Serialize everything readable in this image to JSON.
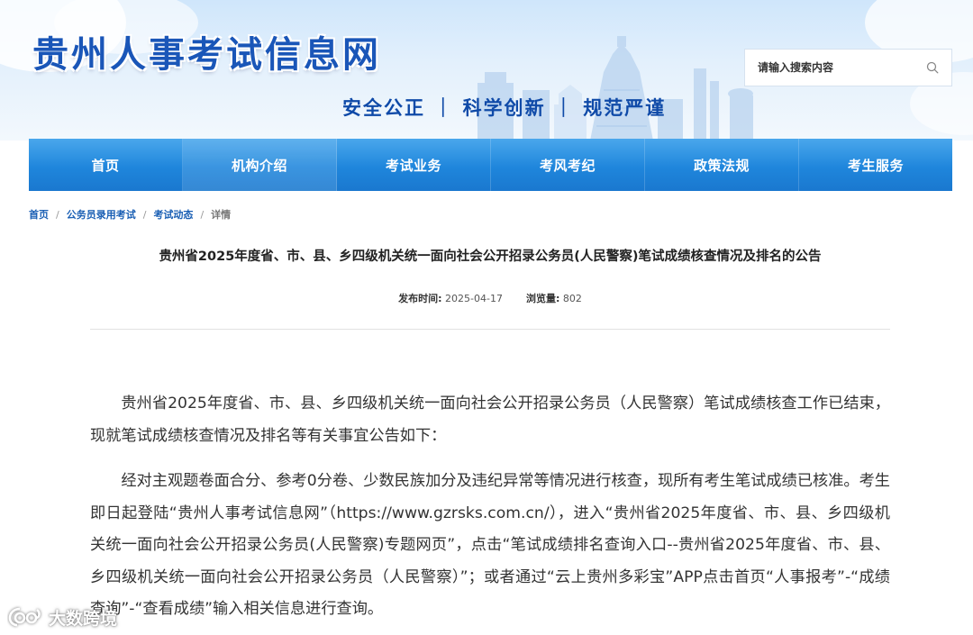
{
  "header": {
    "site_title": "贵州人事考试信息网",
    "slogan": "安全公正 ｜ 科学创新 ｜ 规范严谨",
    "search_placeholder": "请输入搜索内容"
  },
  "nav": {
    "items": [
      {
        "label": "首页"
      },
      {
        "label": "机构介绍"
      },
      {
        "label": "考试业务"
      },
      {
        "label": "考风考纪"
      },
      {
        "label": "政策法规"
      },
      {
        "label": "考生服务"
      }
    ]
  },
  "breadcrumb": {
    "items": [
      "首页",
      "公务员录用考试",
      "考试动态"
    ],
    "current": "详情"
  },
  "article": {
    "title": "贵州省2025年度省、市、县、乡四级机关统一面向社会公开招录公务员(人民警察)笔试成绩核查情况及排名的公告",
    "publish_label": "发布时间:",
    "publish_date": "2025-04-17",
    "views_label": "浏览量:",
    "views": "802",
    "paragraphs": [
      "贵州省2025年度省、市、县、乡四级机关统一面向社会公开招录公务员（人民警察）笔试成绩核查工作已结束，现就笔试成绩核查情况及排名等有关事宜公告如下：",
      "经对主观题卷面合分、参考0分卷、少数民族加分及违纪异常等情况进行核查，现所有考生笔试成绩已核准。考生即日起登陆“贵州人事考试信息网”（https://www.gzrsks.com.cn/），进入“贵州省2025年度省、市、县、乡四级机关统一面向社会公开招录公务员(人民警察)专题网页”，点击“笔试成绩排名查询入口--贵州省2025年度省、市、县、乡四级机关统一面向社会公开招录公务员（人民警察）”；或者通过“云上贵州多彩宝”APP点击首页“人事报考”-“成绩查询”-“查看成绩”输入相关信息进行查询。"
    ]
  },
  "watermark": {
    "text": "大数跨境"
  },
  "colors": {
    "title_blue": "#1a56b8",
    "nav_blue": "#1f86dc",
    "link_blue": "#1a5fb4"
  }
}
